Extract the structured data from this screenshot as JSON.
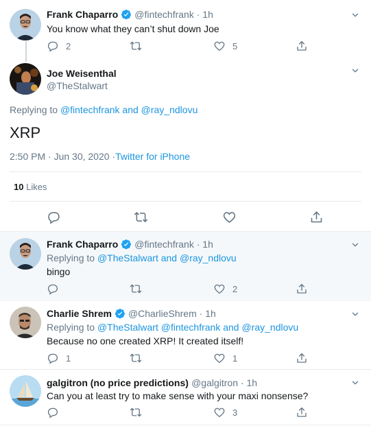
{
  "tweet1": {
    "name": "Frank Chaparro",
    "handle": "@fintechfrank",
    "time": "1h",
    "text": "You know what they can’t shut down Joe",
    "replies": "2",
    "retweets": "",
    "likes": "5"
  },
  "main": {
    "name": "Joe Weisenthal",
    "handle": "@TheStalwart",
    "replying_prefix": "Replying to",
    "replying_users": "@fintechfrank and @ray_ndlovu",
    "text": "XRP",
    "timestamp": "2:50 PM · Jun 30, 2020 · ",
    "source": "Twitter for iPhone",
    "likes_count": "10",
    "likes_label": "Likes"
  },
  "reply1": {
    "name": "Frank Chaparro",
    "handle": "@fintechfrank",
    "time": "1h",
    "replying_prefix": "Replying to",
    "replying_users": "@TheStalwart and @ray_ndlovu",
    "text": "bingo",
    "replies": "",
    "retweets": "",
    "likes": "2"
  },
  "reply2": {
    "name": "Charlie Shrem",
    "handle": "@CharlieShrem",
    "time": "1h",
    "replying_prefix": "Replying to",
    "replying_users": "@TheStalwart @fintechfrank and @ray_ndlovu",
    "text": "Because no one created XRP! It created itself!",
    "replies": "1",
    "retweets": "",
    "likes": "1"
  },
  "reply3": {
    "name": "galgitron (no price predictions)",
    "handle": "@galgitron",
    "time": "1h",
    "text": "Can you at least try to make sense with your maxi nonsense?",
    "replies": "",
    "retweets": "",
    "likes": "3"
  },
  "colors": {
    "accent": "#1b95e0",
    "text": "#14171a",
    "secondary": "#657786",
    "highlight_bg": "#f5f8fa",
    "border": "#e6ecf0"
  }
}
